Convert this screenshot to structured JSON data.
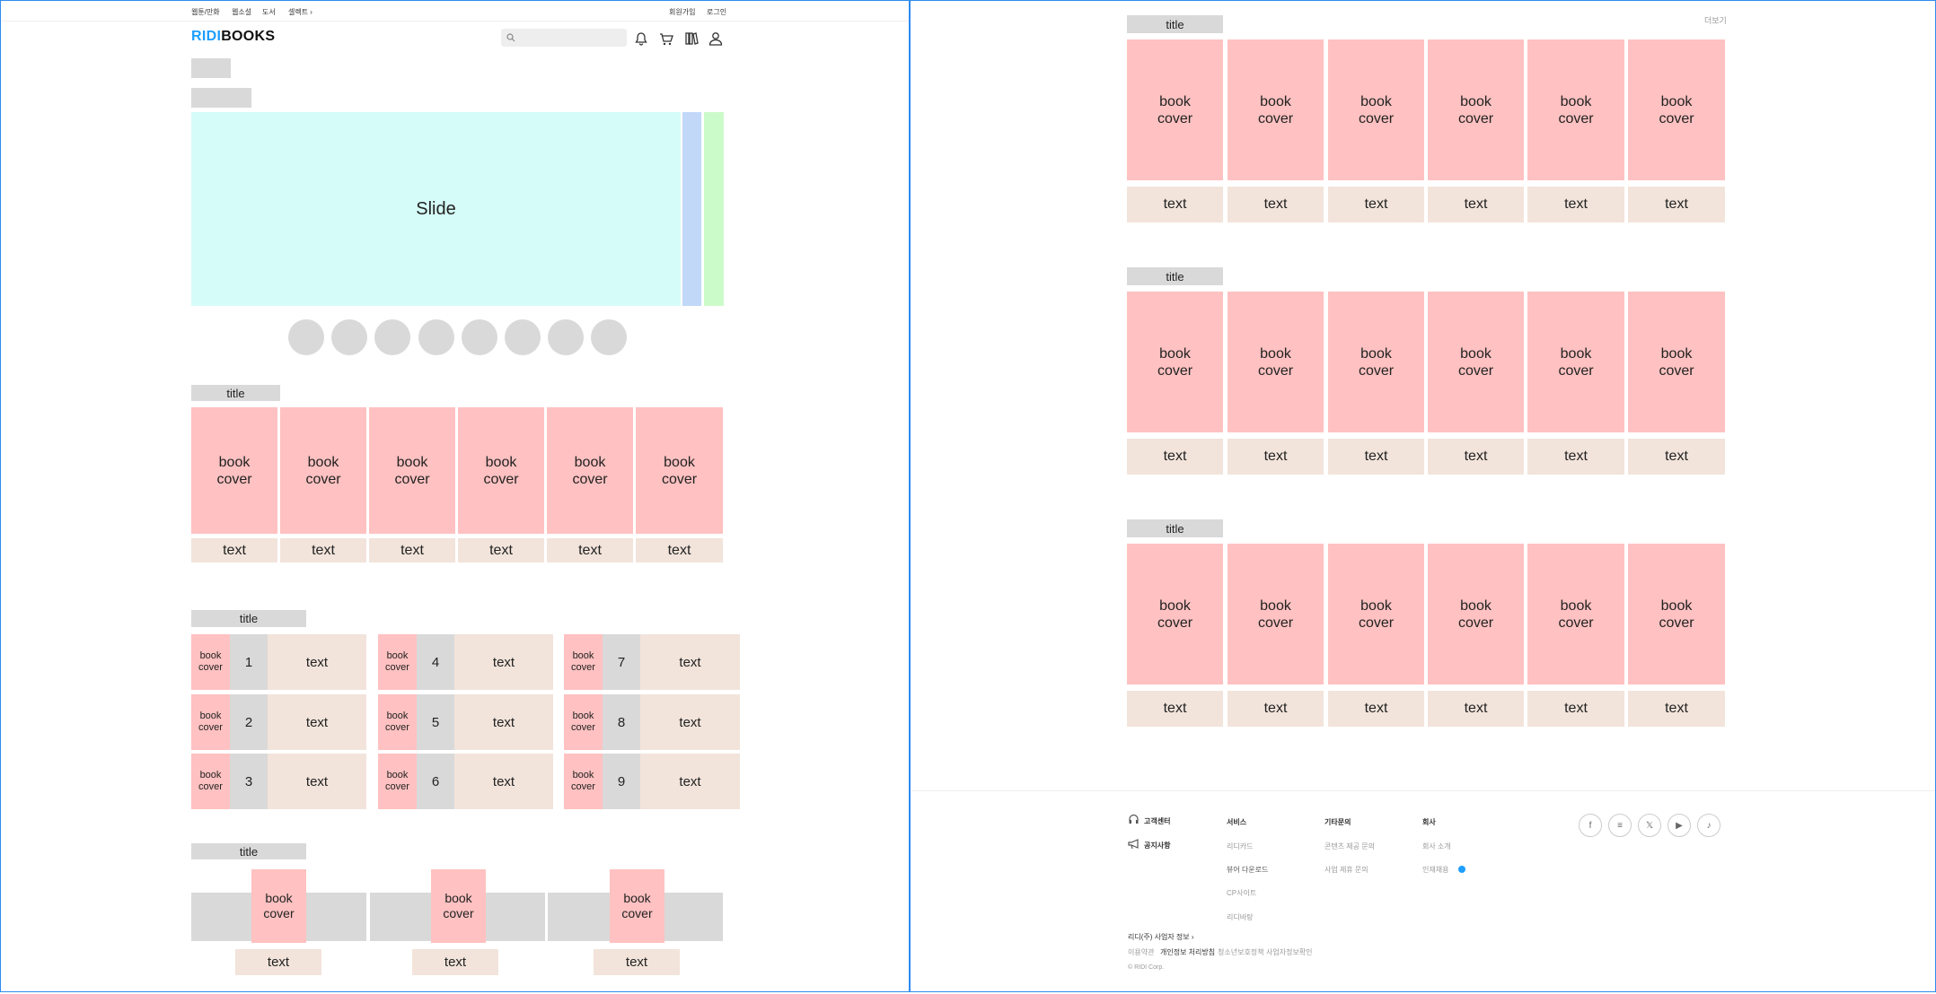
{
  "header": {
    "nav": [
      "웹툰/만화",
      "웹소설",
      "도서",
      "셀렉트 ›"
    ],
    "auth": [
      "회원가입",
      "로그인"
    ],
    "logo_accent": "RIDI",
    "logo_rest": "BOOKS",
    "search_placeholder": ""
  },
  "slider": {
    "label": "Slide"
  },
  "labels": {
    "title": "title",
    "text": "text",
    "book": "book",
    "cover": "cover",
    "more": "더보기"
  },
  "ranking": {
    "numbers": [
      "1",
      "2",
      "3",
      "4",
      "5",
      "6",
      "7",
      "8",
      "9"
    ]
  },
  "footer": {
    "support": [
      "고객센터",
      "공지사항"
    ],
    "columns": [
      {
        "head": "서비스",
        "items": [
          "리디카드",
          "뷰어 다운로드",
          "CP사이트",
          "리디바탕"
        ]
      },
      {
        "head": "기타문의",
        "items": [
          "콘텐츠 제공 문의",
          "사업 제휴 문의"
        ]
      },
      {
        "head": "회사",
        "items": [
          "회사 소개",
          "인재채용"
        ]
      }
    ],
    "biz_info": "리디(주) 사업자 정보 ›",
    "legal": [
      "이용약관",
      "개인정보 처리방침",
      "청소년보호정책",
      "사업자정보확인"
    ],
    "copyright": "© RIDI Corp.",
    "social": [
      "f",
      "≡",
      "𝕏",
      "▶",
      "♪"
    ]
  },
  "colors": {
    "accent": "#1e9eff",
    "frame": "#2d8cf0",
    "slide": "#d5fcf8",
    "slide_next": "#c2d8f8",
    "slide_after": "#cbfbc9",
    "cover": "#ffc1c1",
    "text_box": "#f2e4db",
    "placeholder": "#d9d9d9"
  }
}
